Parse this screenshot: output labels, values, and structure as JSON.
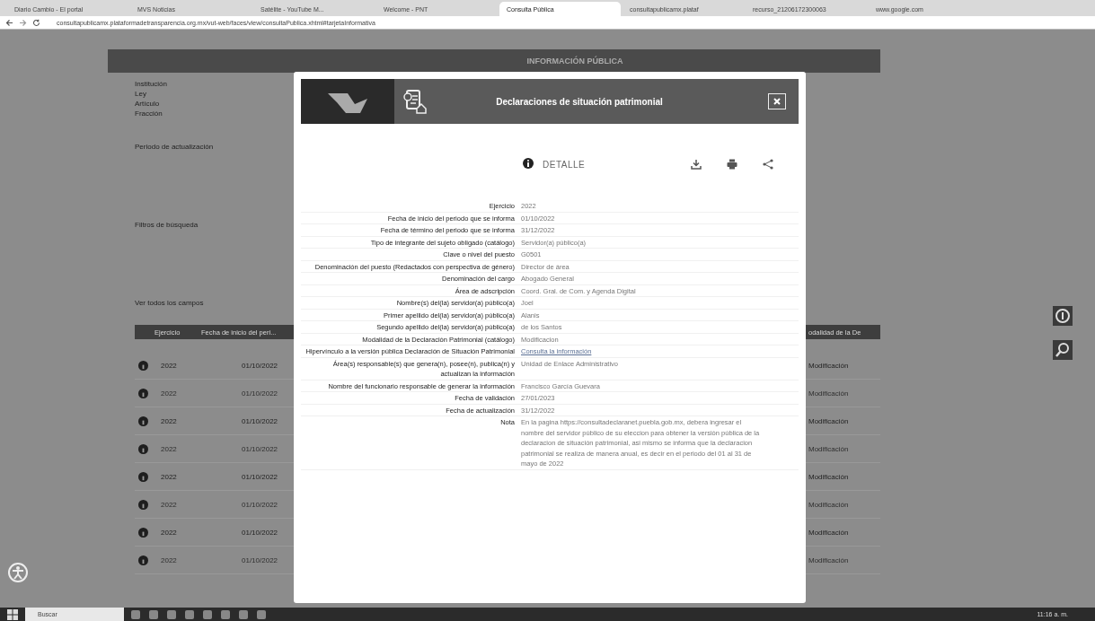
{
  "browser": {
    "tabs": [
      {
        "label": "Diario Cambio - El portal",
        "selected": false
      },
      {
        "label": "MVS Noticias",
        "selected": false
      },
      {
        "label": "Satélite - YouTube M...",
        "selected": false
      },
      {
        "label": "Welcome - PNT",
        "selected": false
      },
      {
        "label": "Consulta Pública",
        "selected": true
      },
      {
        "label": "consultapublicamx.plataf",
        "selected": false
      },
      {
        "label": "recurso_21206172300063",
        "selected": false
      },
      {
        "label": "www.google.com",
        "selected": false
      }
    ],
    "url": "consultapublicamx.plataformadetransparencia.org.mx/vut-web/faces/view/consultaPublica.xhtml#tarjetaInformativa"
  },
  "page": {
    "banner": "INFORMACIÓN PÚBLICA",
    "fields": [
      "Institución",
      "Ley",
      "Artículo",
      "Fracción"
    ],
    "period_label": "Periodo de actualización",
    "filters": "Filtros de búsqueda",
    "show_all": "Ver todos los campos",
    "table": {
      "columns": [
        "Ejercicio",
        "Fecha de inicio del peri...",
        "odalidad de la De"
      ],
      "rows": [
        {
          "ejercicio": "2022",
          "fecha": "01/10/2022",
          "modalidad": "Modificación"
        },
        {
          "ejercicio": "2022",
          "fecha": "01/10/2022",
          "modalidad": "Modificación"
        },
        {
          "ejercicio": "2022",
          "fecha": "01/10/2022",
          "modalidad": "Modificación"
        },
        {
          "ejercicio": "2022",
          "fecha": "01/10/2022",
          "modalidad": "Modificación"
        },
        {
          "ejercicio": "2022",
          "fecha": "01/10/2022",
          "modalidad": "Modificación"
        },
        {
          "ejercicio": "2022",
          "fecha": "01/10/2022",
          "modalidad": "Modificación"
        },
        {
          "ejercicio": "2022",
          "fecha": "01/10/2022",
          "modalidad": "Modificación"
        },
        {
          "ejercicio": "2022",
          "fecha": "01/10/2022",
          "modalidad": "Modificación"
        }
      ]
    }
  },
  "modal": {
    "title": "Declaraciones de situación patrimonial",
    "detail": "DETALLE",
    "fields": [
      {
        "label": "Ejercicio",
        "value": "2022"
      },
      {
        "label": "Fecha de inicio del periodo que se informa",
        "value": "01/10/2022"
      },
      {
        "label": "Fecha de término del periodo que se informa",
        "value": "31/12/2022"
      },
      {
        "label": "Tipo de integrante del sujeto obligado (catálogo)",
        "value": "Servidor(a) público(a)"
      },
      {
        "label": "Clave o nivel del puesto",
        "value": "G0501"
      },
      {
        "label": "Denominación del puesto (Redactados con perspectiva de género)",
        "value": "Director de área"
      },
      {
        "label": "Denominación del cargo",
        "value": "Abogado General"
      },
      {
        "label": "Área de adscripción",
        "value": "Coord. Gral. de Com. y Agenda Digital"
      },
      {
        "label": "Nombre(s) del(la) servidor(a) público(a)",
        "value": "Joel"
      },
      {
        "label": "Primer apellido del(la) servidor(a) público(a)",
        "value": "Alanis"
      },
      {
        "label": "Segundo apellido del(la) servidor(a) público(a)",
        "value": "de los Santos"
      },
      {
        "label": "Modalidad de la Declaración Patrimonial (catálogo)",
        "value": "Modificacion"
      },
      {
        "label": "Hipervínculo a la versión pública Declaración de Situación Patrimonial",
        "value": "Consulta la información",
        "kind": "link"
      },
      {
        "label": "Área(s) responsable(s) que genera(n), posee(n), publica(n) y actualizan la información",
        "value": "Unidad de Enlace Administrativo"
      },
      {
        "label": "Nombre del funcionario responsable de generar la información",
        "value": "Francisco García Guevara"
      },
      {
        "label": "Fecha de validación",
        "value": "27/01/2023"
      },
      {
        "label": "Fecha de actualización",
        "value": "31/12/2022"
      },
      {
        "label": "Nota",
        "value": "En la pagina https://consultadeclaranet.puebla.gob.mx, debera ingresar el nombre del servidor público de su eleccion para obtener la versión pública de la declaracion de situación patrimonial, asi mismo se informa que la declaracion patrimonial se realiza de manera anual, es decir en el periodo del 01 al 31 de mayo de 2022"
      }
    ]
  },
  "taskbar": {
    "search": "Buscar",
    "time": "11:16 a. m."
  }
}
